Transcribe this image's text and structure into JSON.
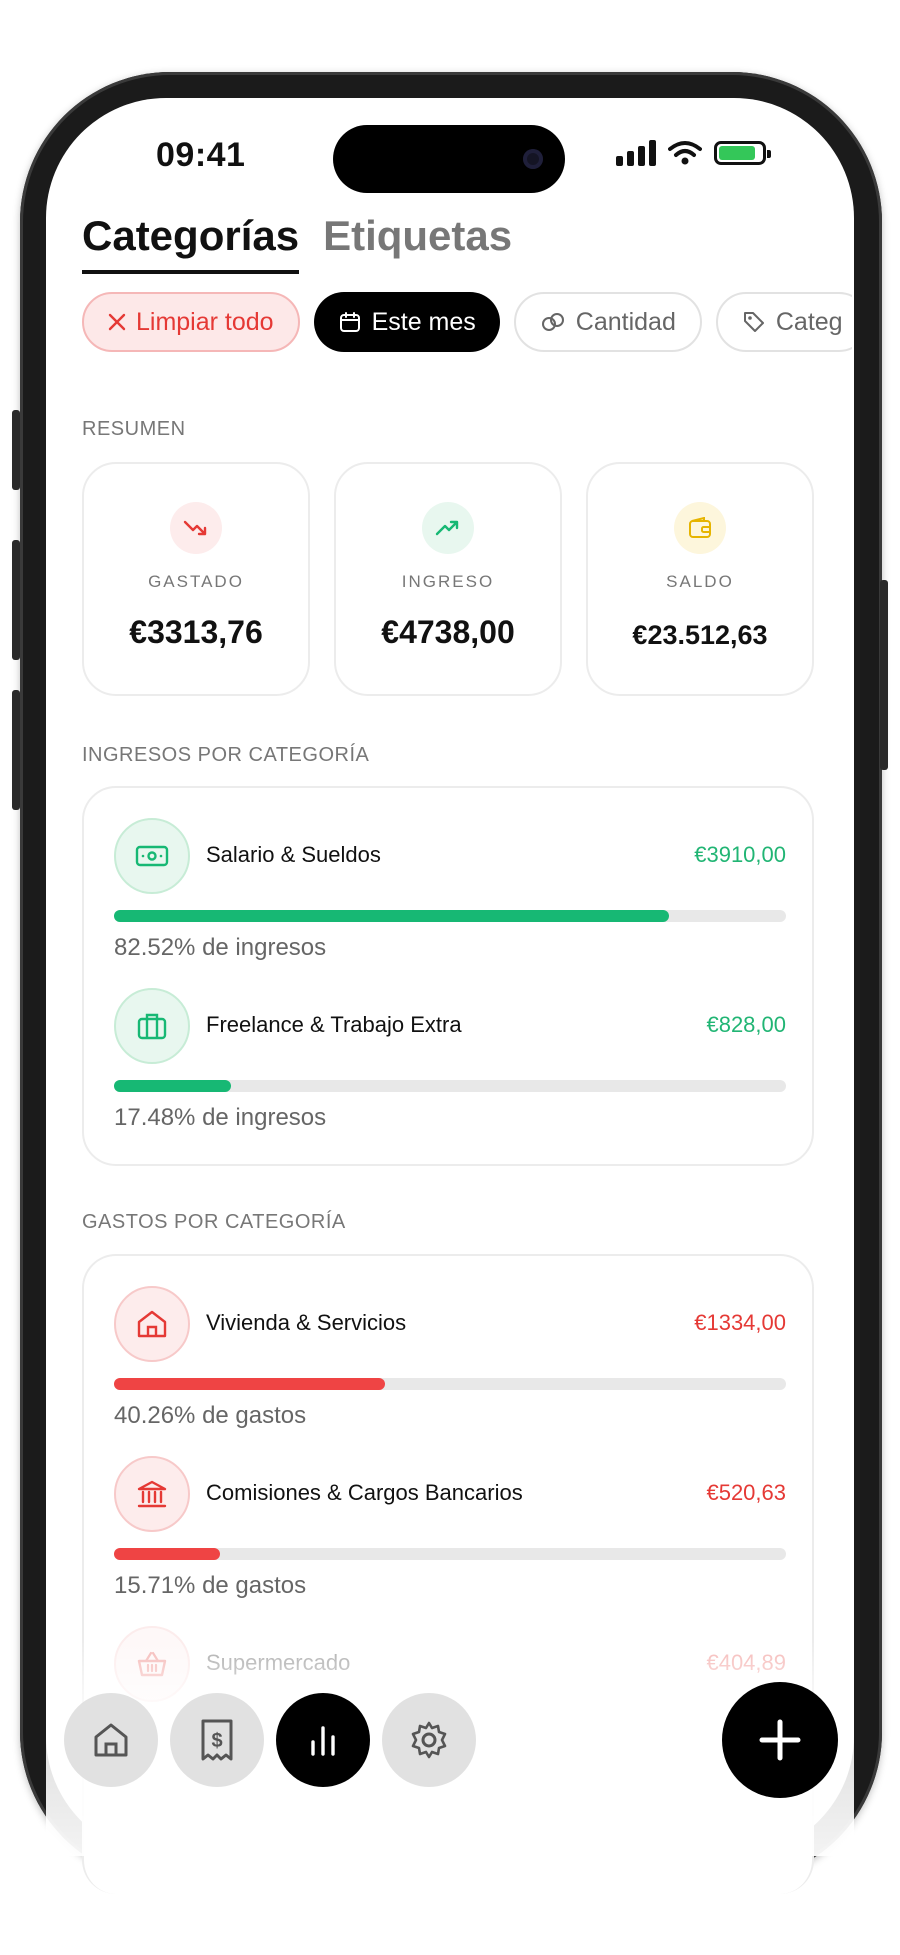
{
  "status": {
    "time": "09:41"
  },
  "tabs": [
    {
      "label": "Categorías",
      "active": true
    },
    {
      "label": "Etiquetas",
      "active": false
    }
  ],
  "filters": [
    {
      "label": "Limpiar todo",
      "icon": "close-icon"
    },
    {
      "label": "Este mes",
      "icon": "calendar-icon"
    },
    {
      "label": "Cantidad",
      "icon": "link-icon"
    },
    {
      "label": "Categ",
      "icon": "tag-icon"
    }
  ],
  "summary": {
    "label": "RESUMEN",
    "cards": [
      {
        "label": "GASTADO",
        "value": "€3313,76",
        "icon": "trending-down-icon"
      },
      {
        "label": "INGRESO",
        "value": "€4738,00",
        "icon": "trending-up-icon"
      },
      {
        "label": "SALDO",
        "value": "€23.512,63",
        "icon": "wallet-icon"
      }
    ]
  },
  "income": {
    "label": "INGRESOS POR CATEGORÍA",
    "items": [
      {
        "name": "Salario & Sueldos",
        "amount": "€3910,00",
        "percent_text": "82.52% de ingresos",
        "share": 0.8252,
        "icon": "banknote-icon"
      },
      {
        "name": "Freelance & Trabajo Extra",
        "amount": "€828,00",
        "percent_text": "17.48% de ingresos",
        "share": 0.1748,
        "icon": "briefcase-icon"
      }
    ]
  },
  "expenses": {
    "label": "GASTOS POR CATEGORÍA",
    "items": [
      {
        "name": "Vivienda & Servicios",
        "amount": "€1334,00",
        "percent_text": "40.26% de gastos",
        "share": 0.4026,
        "icon": "house-icon"
      },
      {
        "name": "Comisiones & Cargos Bancarios",
        "amount": "€520,63",
        "percent_text": "15.71% de gastos",
        "share": 0.1571,
        "icon": "bank-icon"
      },
      {
        "name": "Supermercado",
        "amount": "€404,89",
        "icon": "basket-icon"
      }
    ]
  },
  "nav": [
    {
      "name": "home",
      "icon": "home-icon",
      "active": false
    },
    {
      "name": "transactions",
      "icon": "receipt-icon",
      "active": false
    },
    {
      "name": "stats",
      "icon": "chart-icon",
      "active": true
    },
    {
      "name": "settings",
      "icon": "gear-icon",
      "active": false
    }
  ],
  "colors": {
    "income": "#17b874",
    "expense": "#ef4444",
    "accent": "#000000"
  }
}
